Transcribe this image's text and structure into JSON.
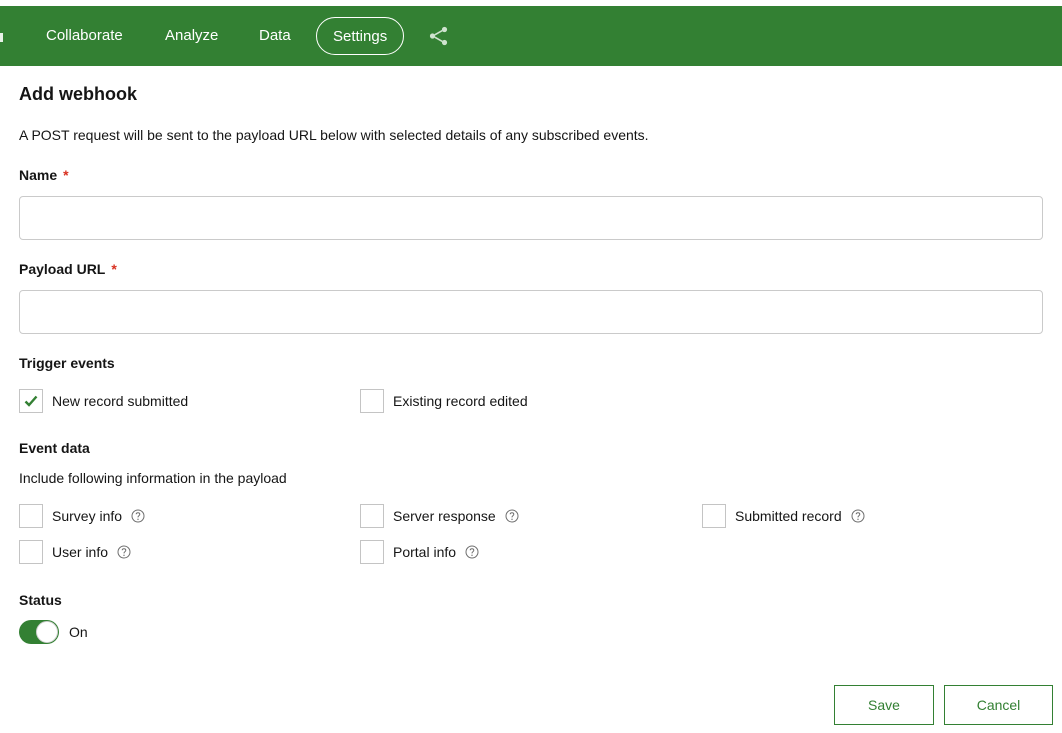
{
  "nav": {
    "items": [
      {
        "label": "Collaborate"
      },
      {
        "label": "Analyze"
      },
      {
        "label": "Data"
      },
      {
        "label": "Settings",
        "active": true
      }
    ],
    "share_icon": "share-icon"
  },
  "form": {
    "title": "Add webhook",
    "description": "A POST request will be sent to the payload URL below with selected details of any subscribed events.",
    "name_label": "Name",
    "name_value": "",
    "required_mark": "*",
    "payload_label": "Payload URL",
    "payload_value": "",
    "trigger_label": "Trigger events",
    "triggers": [
      {
        "label": "New record submitted",
        "checked": true
      },
      {
        "label": "Existing record edited",
        "checked": false
      }
    ],
    "event_data_label": "Event data",
    "event_data_sub": "Include following information in the payload",
    "event_data": [
      {
        "label": "Survey info",
        "checked": false
      },
      {
        "label": "Server response",
        "checked": false
      },
      {
        "label": "Submitted record",
        "checked": false
      },
      {
        "label": "User info",
        "checked": false
      },
      {
        "label": "Portal info",
        "checked": false
      }
    ],
    "status_label": "Status",
    "status_value": "On",
    "status_on": true
  },
  "actions": {
    "save": "Save",
    "cancel": "Cancel"
  },
  "colors": {
    "brand": "#338033",
    "required": "#d83020"
  }
}
